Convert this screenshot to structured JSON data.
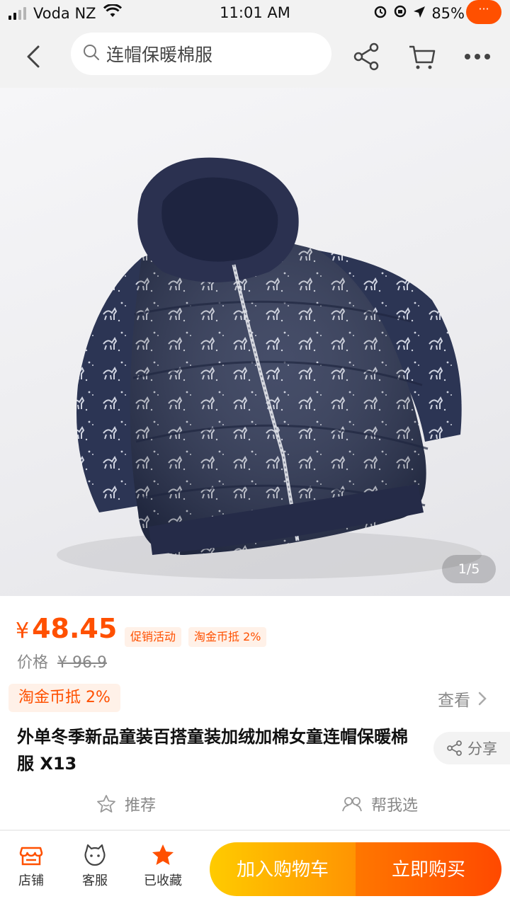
{
  "status_bar": {
    "carrier": "Voda NZ",
    "time": "11:01 AM",
    "battery": "85%"
  },
  "nav": {
    "search_placeholder": "连帽保暖棉服",
    "more_badge": "···"
  },
  "gallery": {
    "page_indicator": "1/5",
    "current_page": 1,
    "total_pages": 5
  },
  "price": {
    "currency": "¥",
    "value": "48.45",
    "tag_promo": "促销活动",
    "tag_coin": "淘金币抵 2%",
    "original_label": "价格",
    "original_value": "¥ 96.9"
  },
  "coin_banner": {
    "text": "淘金币抵 2%",
    "view_label": "查看"
  },
  "product": {
    "title": "外单冬季新品童装百搭童装加绒加棉女童连帽保暖棉服 X13",
    "share_label": "分享"
  },
  "recommend": {
    "left_label": "推荐",
    "right_label": "帮我选"
  },
  "bottom_bar": {
    "shop_label": "店铺",
    "service_label": "客服",
    "favorite_label": "已收藏",
    "add_to_cart": "加入购物车",
    "buy_now": "立即购买"
  },
  "colors": {
    "accent": "#ff5000",
    "cart_gradient_start": "#ffcb00",
    "buy_gradient_end": "#ff4900",
    "jacket": "#2c3554"
  }
}
